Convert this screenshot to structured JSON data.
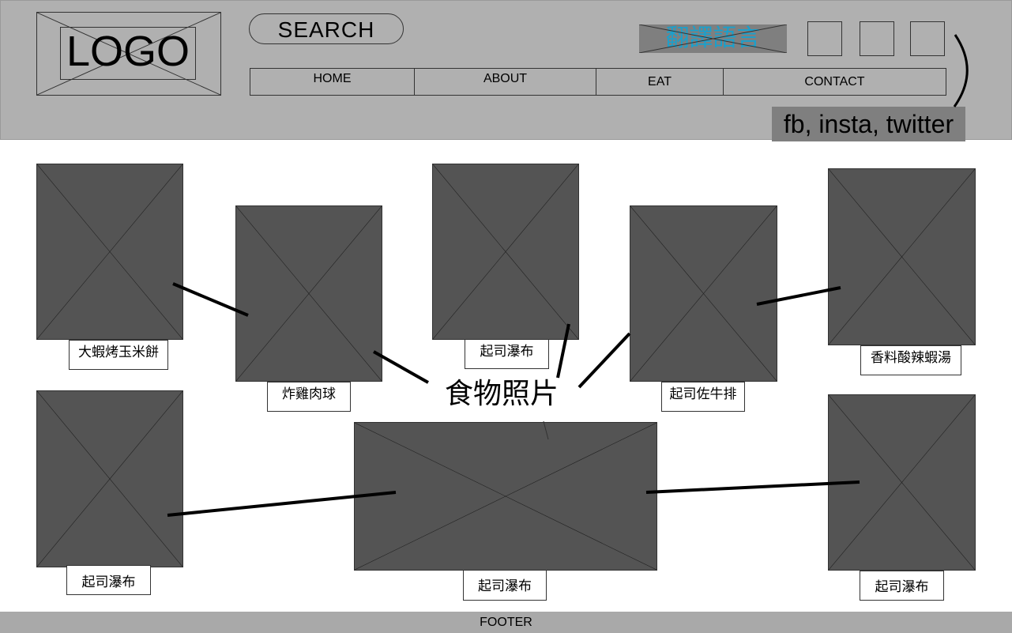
{
  "header": {
    "logo_text": "LOGO",
    "search_label": "SEARCH",
    "translate_label": "翻譯語言",
    "social_label": "fb, insta, twitter",
    "nav": [
      {
        "label": "HOME"
      },
      {
        "label": "ABOUT"
      },
      {
        "label": "EAT"
      },
      {
        "label": "CONTACT"
      }
    ]
  },
  "annotation": {
    "food_photo_label": "食物照片"
  },
  "tiles": [
    {
      "caption": "大蝦烤玉米餅"
    },
    {
      "caption": "炸雞肉球"
    },
    {
      "caption": "起司瀑布"
    },
    {
      "caption": "起司佐牛排"
    },
    {
      "caption": "香料酸辣蝦湯"
    },
    {
      "caption": "起司瀑布"
    },
    {
      "caption": "起司瀑布"
    },
    {
      "caption": "起司瀑布"
    }
  ],
  "footer": {
    "label": "FOOTER"
  },
  "colors": {
    "header_bg": "#b0b0b0",
    "tile_bg": "#545454",
    "translate_text": "#1aa0cc",
    "footer_bg": "#a9a9a9"
  }
}
